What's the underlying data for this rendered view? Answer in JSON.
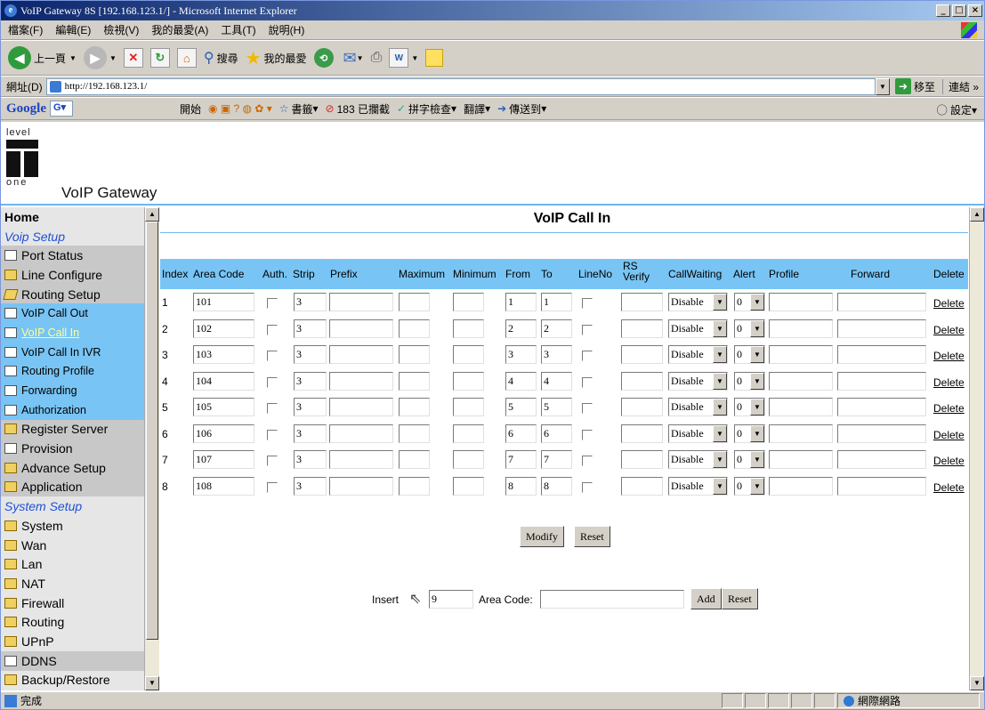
{
  "window": {
    "title": "VoIP Gateway 8S [192.168.123.1/] - Microsoft Internet Explorer",
    "min": "_",
    "max": "□",
    "close": "×"
  },
  "menu": [
    "檔案(F)",
    "編輯(E)",
    "檢視(V)",
    "我的最愛(A)",
    "工具(T)",
    "說明(H)"
  ],
  "toolbar": {
    "back": "上一頁",
    "search": "搜尋",
    "favorites": "我的最愛"
  },
  "address": {
    "label": "網址(D)",
    "url": "http://192.168.123.1/",
    "go": "移至",
    "links": "連結 »"
  },
  "google": {
    "logo": "Google",
    "start": "開始",
    "bookmarks": "書籤",
    "blocked": "183 已攔截",
    "spell": "拼字檢查",
    "translate": "翻譯",
    "sendto": "傳送到",
    "settings": "設定"
  },
  "header": {
    "logo_top": "level",
    "logo_bottom": "one",
    "product": "VoIP Gateway"
  },
  "sidebar": {
    "home": "Home",
    "voip_setup": "Voip Setup",
    "port_status": "Port Status",
    "line_configure": "Line Configure",
    "routing_setup": "Routing Setup",
    "voip_call_out": "VoIP Call Out",
    "voip_call_in": "VoIP Call In",
    "voip_call_in_ivr": "VoIP Call In IVR",
    "routing_profile": "Routing Profile",
    "forwarding": "Forwarding",
    "authorization": "Authorization",
    "register_server": "Register Server",
    "provision": "Provision",
    "advance_setup": "Advance Setup",
    "application": "Application",
    "system_setup": "System Setup",
    "system": "System",
    "wan": "Wan",
    "lan": "Lan",
    "nat": "NAT",
    "firewall": "Firewall",
    "routing": "Routing",
    "upnp": "UPnP",
    "ddns": "DDNS",
    "backup_restore": "Backup/Restore"
  },
  "main": {
    "title": "VoIP Call In",
    "headers": {
      "index": "Index",
      "area_code": "Area Code",
      "auth": "Auth.",
      "strip": "Strip",
      "prefix": "Prefix",
      "maximum": "Maximum",
      "minimum": "Minimum",
      "from": "From",
      "to": "To",
      "lineno": "LineNo",
      "rs_verify_1": "RS",
      "rs_verify_2": "Verify",
      "callwaiting": "CallWaiting",
      "alert": "Alert",
      "profile": "Profile",
      "forward": "Forward",
      "delete": "Delete"
    },
    "rows": [
      {
        "index": "1",
        "area": "101",
        "strip": "3",
        "from": "1",
        "to": "1",
        "cw": "Disable",
        "alert": "0",
        "del": "Delete"
      },
      {
        "index": "2",
        "area": "102",
        "strip": "3",
        "from": "2",
        "to": "2",
        "cw": "Disable",
        "alert": "0",
        "del": "Delete"
      },
      {
        "index": "3",
        "area": "103",
        "strip": "3",
        "from": "3",
        "to": "3",
        "cw": "Disable",
        "alert": "0",
        "del": "Delete"
      },
      {
        "index": "4",
        "area": "104",
        "strip": "3",
        "from": "4",
        "to": "4",
        "cw": "Disable",
        "alert": "0",
        "del": "Delete"
      },
      {
        "index": "5",
        "area": "105",
        "strip": "3",
        "from": "5",
        "to": "5",
        "cw": "Disable",
        "alert": "0",
        "del": "Delete"
      },
      {
        "index": "6",
        "area": "106",
        "strip": "3",
        "from": "6",
        "to": "6",
        "cw": "Disable",
        "alert": "0",
        "del": "Delete"
      },
      {
        "index": "7",
        "area": "107",
        "strip": "3",
        "from": "7",
        "to": "7",
        "cw": "Disable",
        "alert": "0",
        "del": "Delete"
      },
      {
        "index": "8",
        "area": "108",
        "strip": "3",
        "from": "8",
        "to": "8",
        "cw": "Disable",
        "alert": "0",
        "del": "Delete"
      }
    ],
    "modify": "Modify",
    "reset": "Reset",
    "insert_label": "Insert",
    "insert_value": "9",
    "area_code_label": "Area Code:",
    "add": "Add",
    "reset2": "Reset"
  },
  "status": {
    "text": "完成",
    "zone": "網際網路"
  }
}
